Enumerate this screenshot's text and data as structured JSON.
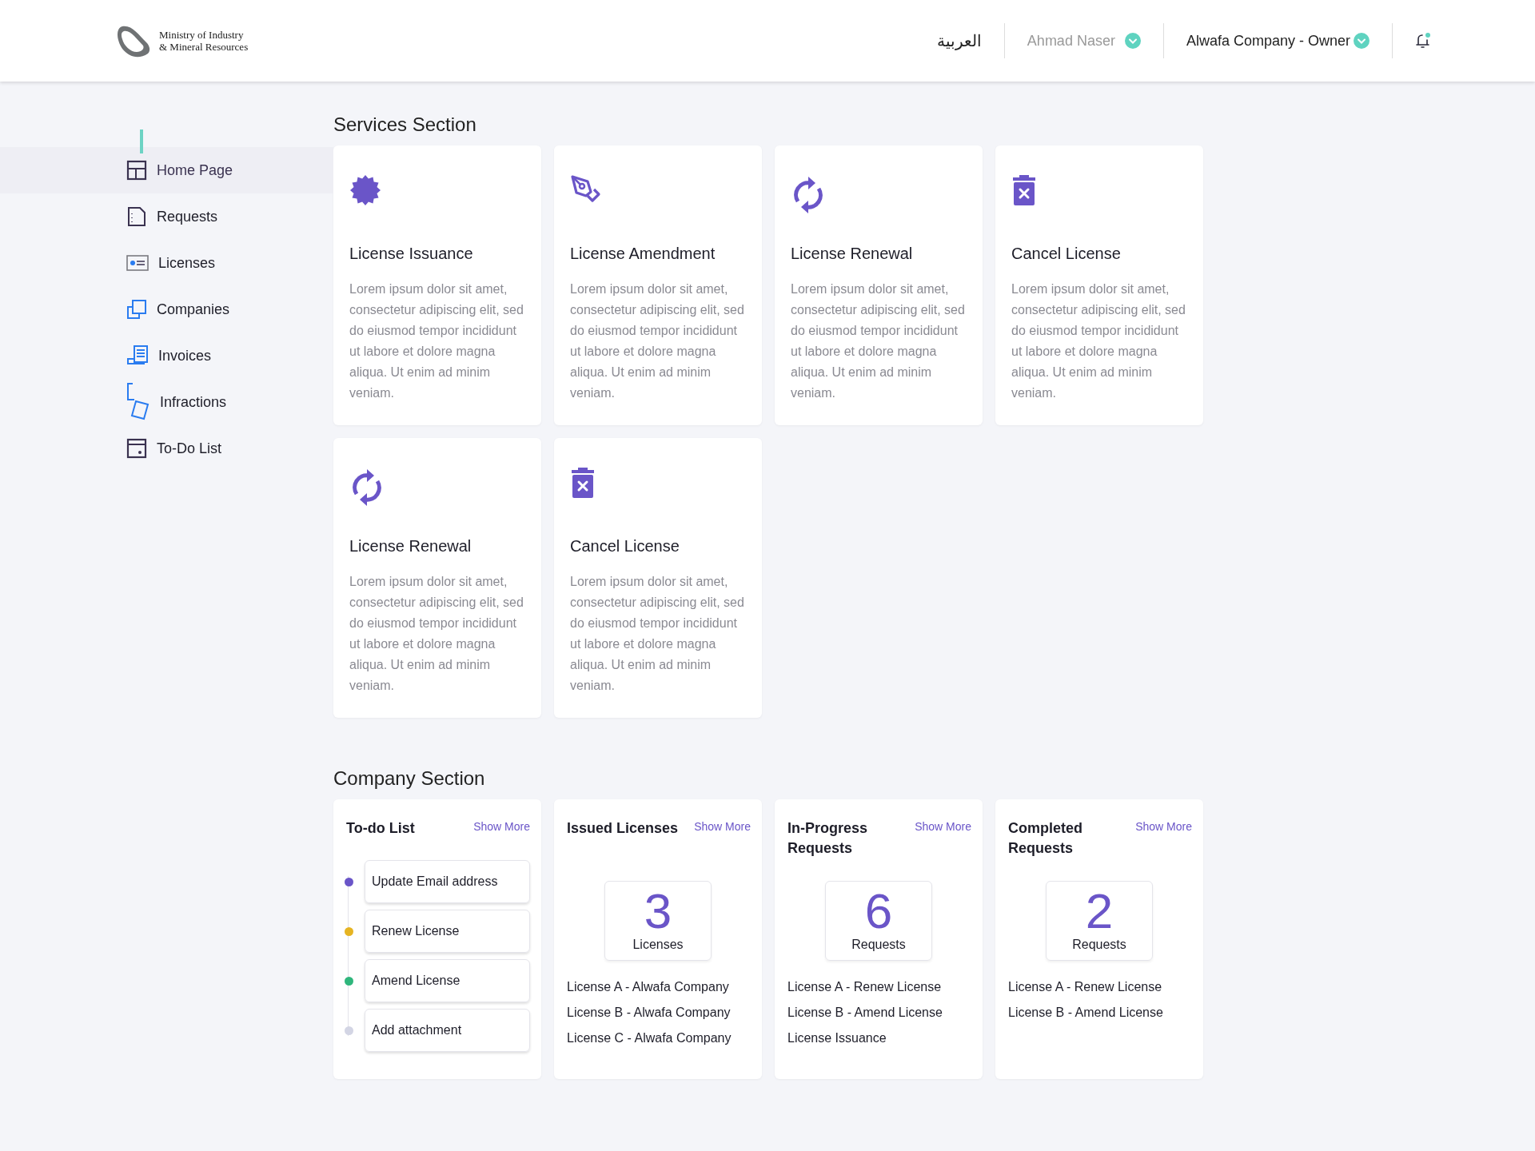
{
  "header": {
    "logo_lines": [
      "Ministry of Industry",
      "& Mineral Resources"
    ],
    "language": "العربية",
    "user": "Ahmad Naser",
    "account": "Alwafa Company - Owner",
    "notification": true
  },
  "sidebar": {
    "items": [
      {
        "label": "Home Page",
        "kind": "layout",
        "selected": true
      },
      {
        "label": "Requests",
        "kind": "document",
        "selected": false
      },
      {
        "label": "Licenses",
        "kind": "idcard",
        "selected": false
      },
      {
        "label": "Companies",
        "kind": "copy",
        "selected": false
      },
      {
        "label": "Invoices",
        "kind": "invoice",
        "selected": false
      },
      {
        "label": "Infractions",
        "kind": "infraction",
        "selected": false
      },
      {
        "label": "To-Do List",
        "kind": "calendar",
        "selected": false
      }
    ]
  },
  "services": {
    "title": "Services Section",
    "cards": [
      {
        "kind": "badge",
        "title": "License Issuance",
        "description": "Lorem ipsum dolor sit amet, consectetur adipiscing elit, sed do eiusmod tempor incididunt ut labore et dolore magna aliqua. Ut enim ad minim veniam."
      },
      {
        "kind": "pen",
        "title": "License Amendment",
        "description": "Lorem ipsum dolor sit amet, consectetur adipiscing elit, sed do eiusmod tempor incididunt ut labore et dolore magna aliqua. Ut enim ad minim veniam."
      },
      {
        "kind": "refresh",
        "title": "License Renewal",
        "description": "Lorem ipsum dolor sit amet, consectetur adipiscing elit, sed do eiusmod tempor incididunt ut labore et dolore magna aliqua. Ut enim ad minim veniam."
      },
      {
        "kind": "trash",
        "title": "Cancel License",
        "description": "Lorem ipsum dolor sit amet, consectetur adipiscing elit, sed do eiusmod tempor incididunt ut labore et dolore magna aliqua. Ut enim ad minim veniam."
      },
      {
        "kind": "refresh",
        "title": "License Renewal",
        "description": "Lorem ipsum dolor sit amet, consectetur adipiscing elit, sed do eiusmod tempor incididunt ut labore et dolore magna aliqua. Ut enim ad minim veniam."
      },
      {
        "kind": "trash",
        "title": "Cancel License",
        "description": "Lorem ipsum dolor sit amet, consectetur adipiscing elit, sed do eiusmod tempor incididunt ut labore et dolore magna aliqua. Ut enim ad minim veniam."
      }
    ]
  },
  "company": {
    "title": "Company Section",
    "todo": {
      "title": "To-do List",
      "show_more": "Show More",
      "items": [
        {
          "label": "Update Email address",
          "color": "#6a55c8"
        },
        {
          "label": "Renew License",
          "color": "#e6b422"
        },
        {
          "label": "Amend License",
          "color": "#2fb67c"
        },
        {
          "label": "Add attachment",
          "color": "#d3d5e4"
        }
      ]
    },
    "stats": [
      {
        "title": "Issued Licenses",
        "show_more": "Show More",
        "count": "3",
        "unit": "Licenses",
        "items": [
          "License A - Alwafa Company",
          "License B - Alwafa Company",
          "License C - Alwafa Company"
        ]
      },
      {
        "title": "In-Progress Requests",
        "show_more": "Show More",
        "count": "6",
        "unit": "Requests",
        "items": [
          "License A - Renew License",
          "License B - Amend License",
          "License Issuance"
        ]
      },
      {
        "title": "Completed Requests",
        "show_more": "Show More",
        "count": "2",
        "unit": "Requests",
        "items": [
          "License A - Renew License",
          "License B - Amend License"
        ]
      }
    ]
  }
}
